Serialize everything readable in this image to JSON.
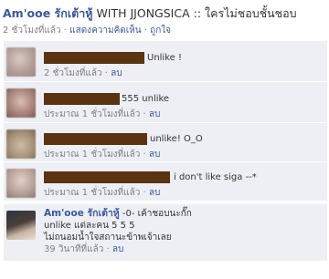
{
  "post": {
    "author": "Am'ooe รักเต้าหู้",
    "text": " WITH JJONGSICA :: ใครไม่ชอบชั้นชอบ",
    "time": "2 ชั่วโมงที่แล้ว",
    "separator": "·",
    "comment_link": "แสดงความคิดเห็น",
    "like_link": "ถูกใจ"
  },
  "comments": [
    {
      "text": "Unlike !",
      "time": "2 ชั่วโมงที่แล้ว",
      "delete": "ลบ"
    },
    {
      "text": "555 unlike",
      "time": "ประมาณ 1 ชั่วโมงที่แล้ว",
      "delete": "ลบ"
    },
    {
      "text": "unlike! O_O",
      "time": "ประมาณ 1 ชั่วโมงที่แล้ว",
      "delete": "ลบ"
    },
    {
      "text": "i don't like siga --*",
      "time": "ประมาณ 1 ชั่วโมงที่แล้ว",
      "delete": "ลบ"
    }
  ],
  "reply": {
    "author": "Am'ooe รักเต้าหู้",
    "line1": " -0- เค้าชอบนะกั๊ก",
    "line2": "unlike แต่ละคน 5 5 5",
    "line3": "ไม่ถนอมน้ำใจสถานะข้าพเจ้าเลย",
    "time": "39 วินาทีที่แล้ว",
    "delete": "ลบ"
  },
  "colors": {
    "link": "#3b5998",
    "comment_bg": "#edeff4",
    "redaction": "#5a3310",
    "meta": "#7f7f7f"
  }
}
